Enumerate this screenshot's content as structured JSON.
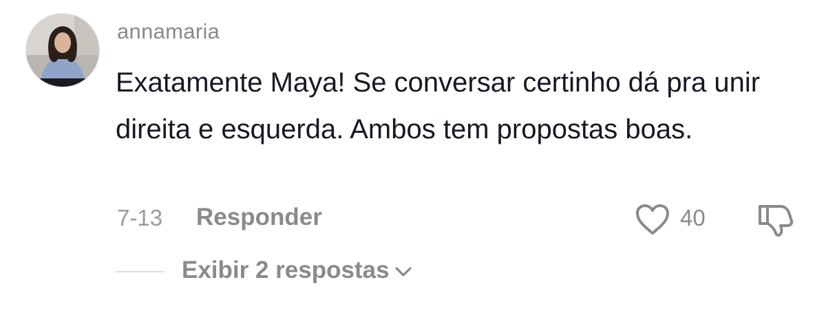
{
  "comment": {
    "username": "annamaria",
    "avatar_icon": "user-avatar-photo",
    "text": "Exatamente Maya! Se conversar certinho dá pra unir direita e esquerda. Ambos tem propostas boas.",
    "date": "7-13",
    "reply_label": "Responder",
    "like_icon": "heart-outline-icon",
    "like_count": "40",
    "dislike_icon": "thumbs-down-icon"
  },
  "replies": {
    "label": "Exibir 2 respostas",
    "chevron_icon": "chevron-down-icon"
  }
}
